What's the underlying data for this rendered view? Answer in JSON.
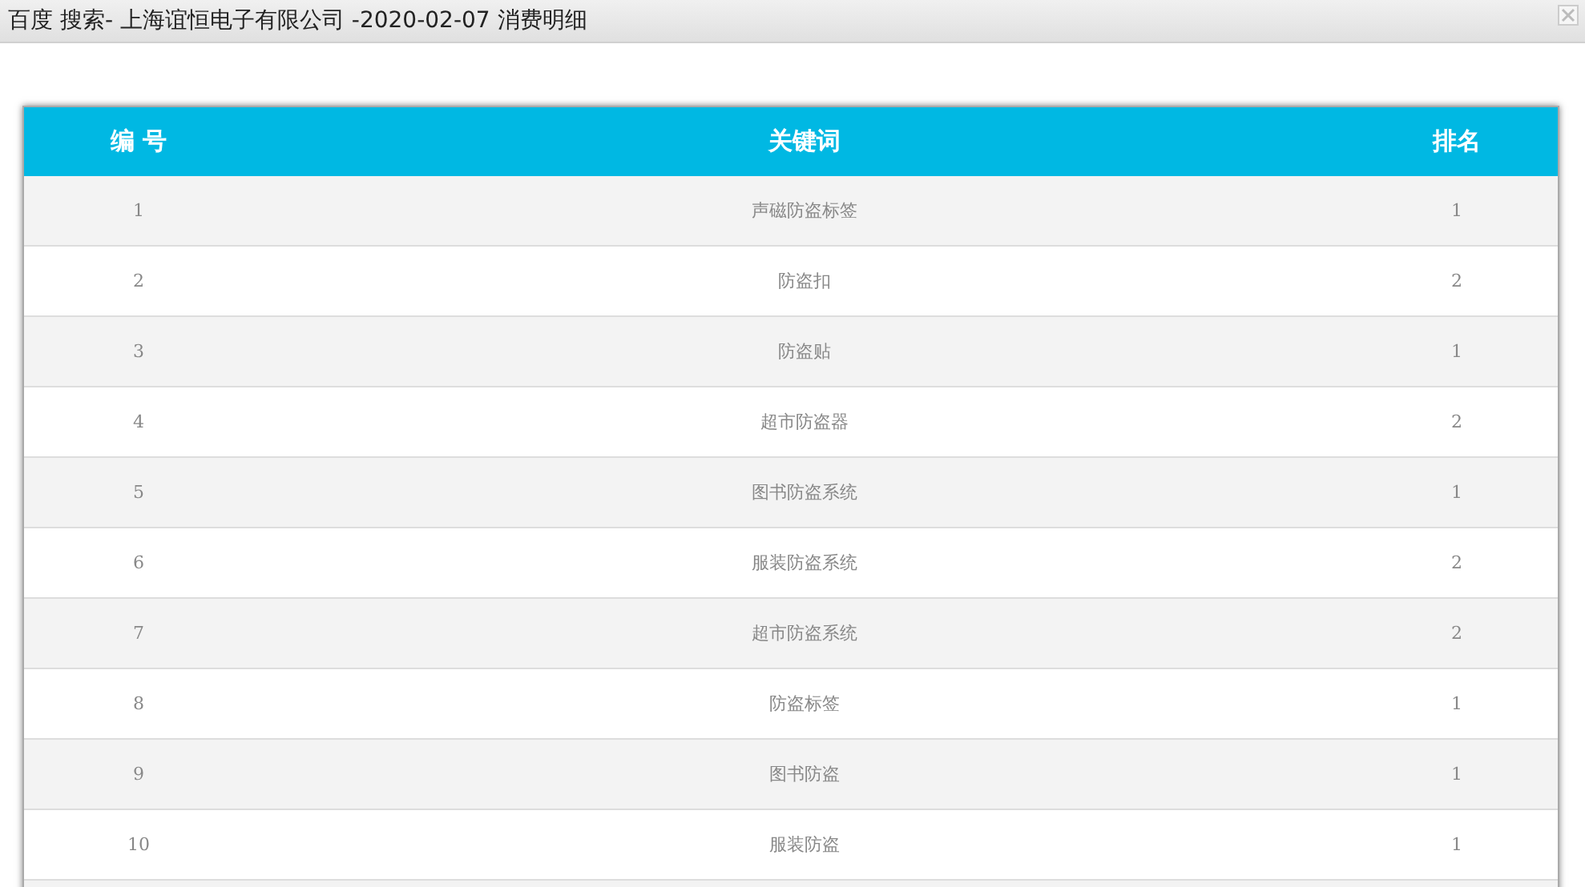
{
  "window": {
    "title": "百度 搜索- 上海谊恒电子有限公司 -2020-02-07 消费明细"
  },
  "table": {
    "columns": [
      "编 号",
      "关键词",
      "排名"
    ],
    "rows": [
      [
        "1",
        "声磁防盗标签",
        "1"
      ],
      [
        "2",
        "防盗扣",
        "2"
      ],
      [
        "3",
        "防盗贴",
        "1"
      ],
      [
        "4",
        "超市防盗器",
        "2"
      ],
      [
        "5",
        "图书防盗系统",
        "1"
      ],
      [
        "6",
        "服装防盗系统",
        "2"
      ],
      [
        "7",
        "超市防盗系统",
        "2"
      ],
      [
        "8",
        "防盗标签",
        "1"
      ],
      [
        "9",
        "图书防盗",
        "1"
      ],
      [
        "10",
        "服装防盗",
        "1"
      ]
    ]
  }
}
